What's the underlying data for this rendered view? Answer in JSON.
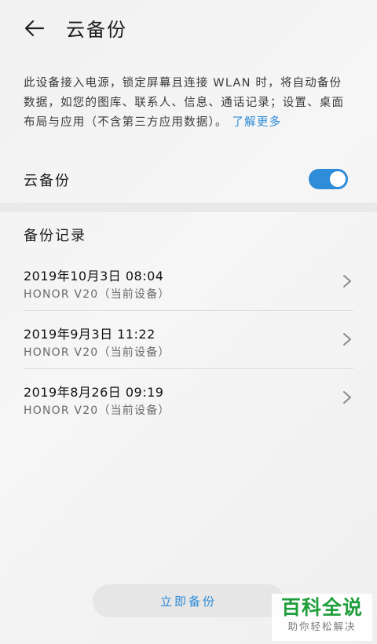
{
  "header": {
    "title": "云备份",
    "back_icon": "arrow-left-icon"
  },
  "description": {
    "text": "此设备接入电源，锁定屏幕且连接 WLAN 时，将自动备份数据，如您的图库、联系人、信息、通话记录；设置、桌面布局与应用（不含第三方应用数据）。",
    "learn_more": "了解更多"
  },
  "cloud_backup": {
    "label": "云备份",
    "enabled": true
  },
  "records": {
    "title": "备份记录",
    "items": [
      {
        "date": "2019年10月3日 08:04",
        "device": "HONOR V20（当前设备）"
      },
      {
        "date": "2019年9月3日 11:22",
        "device": "HONOR V20（当前设备）"
      },
      {
        "date": "2019年8月26日 09:19",
        "device": "HONOR V20（当前设备）"
      }
    ]
  },
  "actions": {
    "backup_now": "立即备份"
  },
  "watermark": {
    "main": "百科全说",
    "sub": "助你轻松解决"
  },
  "colors": {
    "accent": "#2f8cd8",
    "watermark": "#1f9e3b"
  }
}
